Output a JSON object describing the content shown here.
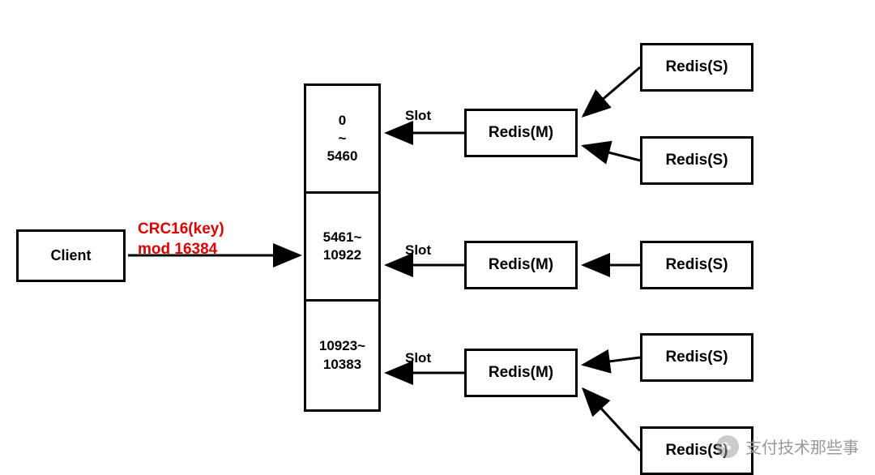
{
  "client": {
    "label": "Client"
  },
  "hash": {
    "line1": "CRC16(key)",
    "line2": "mod 16384"
  },
  "slots": [
    {
      "line1": "0",
      "line2": "~",
      "line3": "5460"
    },
    {
      "line1": "5461~",
      "line2": "10922",
      "line3": ""
    },
    {
      "line1": "10923~",
      "line2": "10383",
      "line3": ""
    }
  ],
  "slot_labels": [
    "Slot",
    "Slot",
    "Slot"
  ],
  "masters": [
    {
      "label": "Redis(M)"
    },
    {
      "label": "Redis(M)"
    },
    {
      "label": "Redis(M)"
    }
  ],
  "slaves": [
    {
      "label": "Redis(S)"
    },
    {
      "label": "Redis(S)"
    },
    {
      "label": "Redis(S)"
    },
    {
      "label": "Redis(S)"
    },
    {
      "label": "Redis(S)"
    }
  ],
  "watermark": {
    "text": "支付技术那些事"
  }
}
